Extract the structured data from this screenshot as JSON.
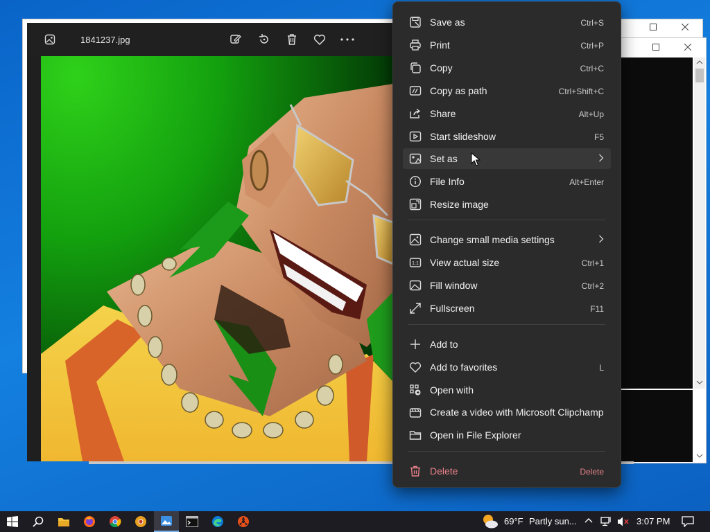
{
  "viewer": {
    "filename": "1841237.jpg"
  },
  "menu": {
    "items": [
      {
        "label": "Save as",
        "shortcut": "Ctrl+S",
        "icon": "save-as-icon"
      },
      {
        "label": "Print",
        "shortcut": "Ctrl+P",
        "icon": "print-icon"
      },
      {
        "label": "Copy",
        "shortcut": "Ctrl+C",
        "icon": "copy-icon"
      },
      {
        "label": "Copy as path",
        "shortcut": "Ctrl+Shift+C",
        "icon": "copy-path-icon"
      },
      {
        "label": "Share",
        "shortcut": "Alt+Up",
        "icon": "share-icon"
      },
      {
        "label": "Start slideshow",
        "shortcut": "F5",
        "icon": "slideshow-icon"
      },
      {
        "label": "Set as",
        "shortcut": "",
        "icon": "set-as-icon"
      },
      {
        "label": "File Info",
        "shortcut": "Alt+Enter",
        "icon": "info-icon"
      },
      {
        "label": "Resize image",
        "shortcut": "",
        "icon": "resize-icon"
      },
      {
        "label": "Change small media settings",
        "shortcut": "",
        "icon": "media-settings-icon"
      },
      {
        "label": "View actual size",
        "shortcut": "Ctrl+1",
        "icon": "actual-size-icon"
      },
      {
        "label": "Fill window",
        "shortcut": "Ctrl+2",
        "icon": "fill-window-icon"
      },
      {
        "label": "Fullscreen",
        "shortcut": "F11",
        "icon": "fullscreen-icon"
      },
      {
        "label": "Add to",
        "shortcut": "",
        "icon": "plus-icon"
      },
      {
        "label": "Add to favorites",
        "shortcut": "L",
        "icon": "heart-icon"
      },
      {
        "label": "Open with",
        "shortcut": "",
        "icon": "open-with-icon"
      },
      {
        "label": "Create a video with Microsoft Clipchamp",
        "shortcut": "",
        "icon": "clipchamp-icon"
      },
      {
        "label": "Open in File Explorer",
        "shortcut": "",
        "icon": "folder-icon"
      },
      {
        "label": "Delete",
        "shortcut": "Delete",
        "icon": "trash-icon"
      }
    ]
  },
  "taskbar": {
    "weather_temp": "69°F",
    "weather_desc": "Partly sun...",
    "clock": "3:07 PM"
  },
  "colors": {
    "menu_bg": "#2b2b2b",
    "delete_text": "#e8818a",
    "taskbar_bg": "#1c1c22"
  }
}
